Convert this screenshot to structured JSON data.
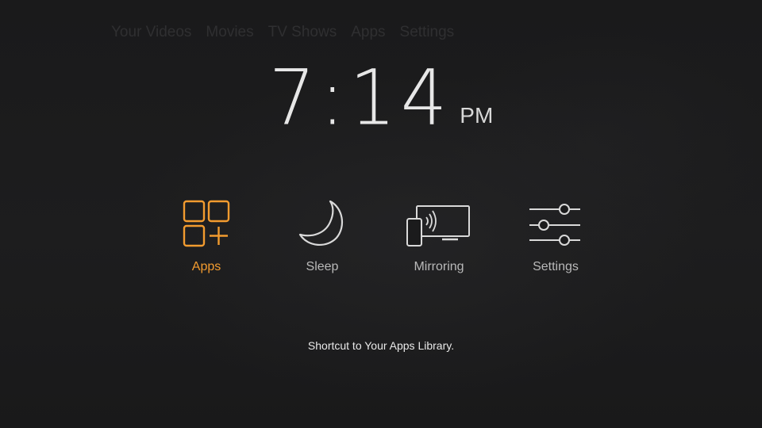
{
  "nav": {
    "items": [
      "Your Videos",
      "Movies",
      "TV Shows",
      "Apps",
      "Settings"
    ]
  },
  "clock": {
    "time": "7:14",
    "ampm": "PM"
  },
  "shortcuts": [
    {
      "label": "Apps",
      "icon": "apps-grid-icon"
    },
    {
      "label": "Sleep",
      "icon": "moon-icon"
    },
    {
      "label": "Mirroring",
      "icon": "mirroring-icon"
    },
    {
      "label": "Settings",
      "icon": "sliders-icon"
    }
  ],
  "selected_shortcut": "Apps",
  "hint": "Shortcut to Your Apps Library.",
  "colors": {
    "accent": "#f29b2f",
    "background": "#1b1b1c",
    "icon": "#d9d9d9"
  }
}
